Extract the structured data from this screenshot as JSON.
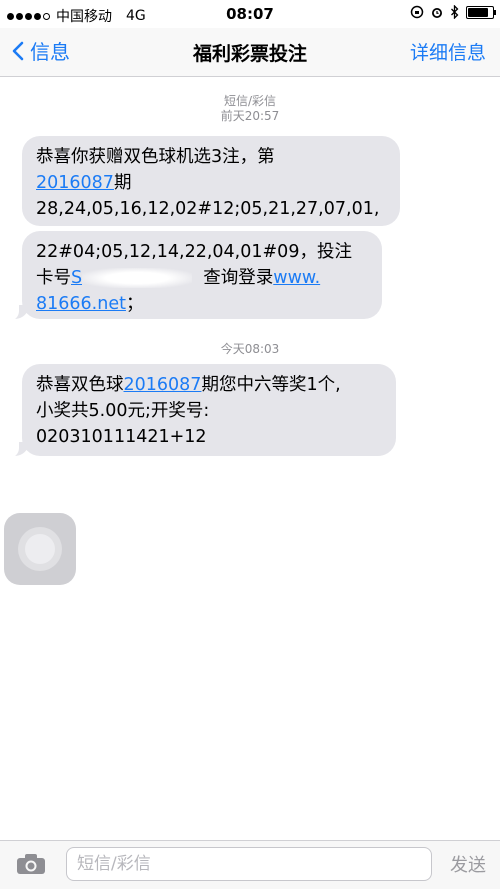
{
  "status_bar": {
    "carrier": "中国移动",
    "network": "4G",
    "time": "08:07",
    "signal_bars": 4,
    "battery_level": 0.9
  },
  "nav": {
    "back_label": "信息",
    "title": "福利彩票投注",
    "detail_label": "详细信息"
  },
  "thread": {
    "header_line1": "短信/彩信",
    "header_line2": "前天20:57",
    "second_timestamp": "今天08:03"
  },
  "messages": [
    {
      "p1": "恭喜你获赠双色球机选3注，第\n",
      "issue": "2016087",
      "p2": "期\n28,24,05,16,12,02#12;05,21,27,07,01,"
    },
    {
      "p1": "22#04;05,12,14,22,04,01#09，投注\n卡号",
      "card_fragment": "S",
      "p2": "  查询登录",
      "link1": "www.",
      "link2": "81666.net",
      "p3": "；"
    },
    {
      "p1": "恭喜双色球",
      "issue": "2016087",
      "p2": "期您中六等奖1个,\n小奖共5.00元;开奖号:\n020310111421+12"
    }
  ],
  "composer": {
    "placeholder": "短信/彩信",
    "send_label": "发送"
  },
  "colors": {
    "accent": "#1b7bf5",
    "bubble": "#e5e5ea",
    "timestamp": "#8e8e93"
  },
  "icons": [
    "camera-icon",
    "chevron-left-icon",
    "alarm-icon",
    "bluetooth-icon",
    "rotation-lock-icon",
    "battery-icon"
  ]
}
